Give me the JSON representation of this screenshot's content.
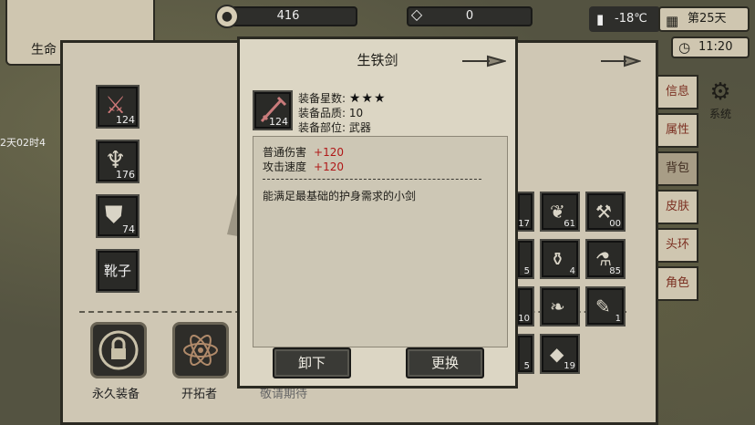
{
  "resources": {
    "coins": "416",
    "gems": "0"
  },
  "status": {
    "temperature": "-18℃",
    "day": "第25天",
    "time": "11:20"
  },
  "portrait": {
    "life_label": "生命"
  },
  "left_edge_text": "2天02时4",
  "equipment": {
    "slots": [
      {
        "name": "sword",
        "count": "124"
      },
      {
        "name": "chest",
        "count": "176"
      },
      {
        "name": "armor",
        "count": "74"
      },
      {
        "name": "boots",
        "label": "靴子"
      }
    ],
    "bottom": [
      {
        "label": "永久装备"
      },
      {
        "label": "开拓者"
      },
      {
        "label": "敬请期待"
      }
    ]
  },
  "side_tabs": [
    "信息",
    "属性",
    "背包",
    "皮肤",
    "头环",
    "角色"
  ],
  "active_tab": "背包",
  "settings_label": "系统",
  "popup": {
    "title": "生铁剑",
    "item_count": "124",
    "star_label": "装备星数:",
    "stars": "★★★",
    "quality_label": "装备品质:",
    "quality": "10",
    "slot_label": "装备部位:",
    "slot": "武器",
    "stats": [
      {
        "name": "普通伤害",
        "bonus": "+120"
      },
      {
        "name": "攻击速度",
        "bonus": "+120"
      }
    ],
    "description": "能满足最基础的护身需求的小剑",
    "unequip_label": "卸下",
    "replace_label": "更换"
  },
  "bag": [
    {
      "count": "17"
    },
    {
      "count": "61"
    },
    {
      "count": "00"
    },
    {
      "count": "5"
    },
    {
      "count": "4"
    },
    {
      "count": "85"
    },
    {
      "count": "10"
    },
    {
      "count": ""
    },
    {
      "count": "1"
    },
    {
      "count": "5"
    },
    {
      "count": "19"
    }
  ]
}
